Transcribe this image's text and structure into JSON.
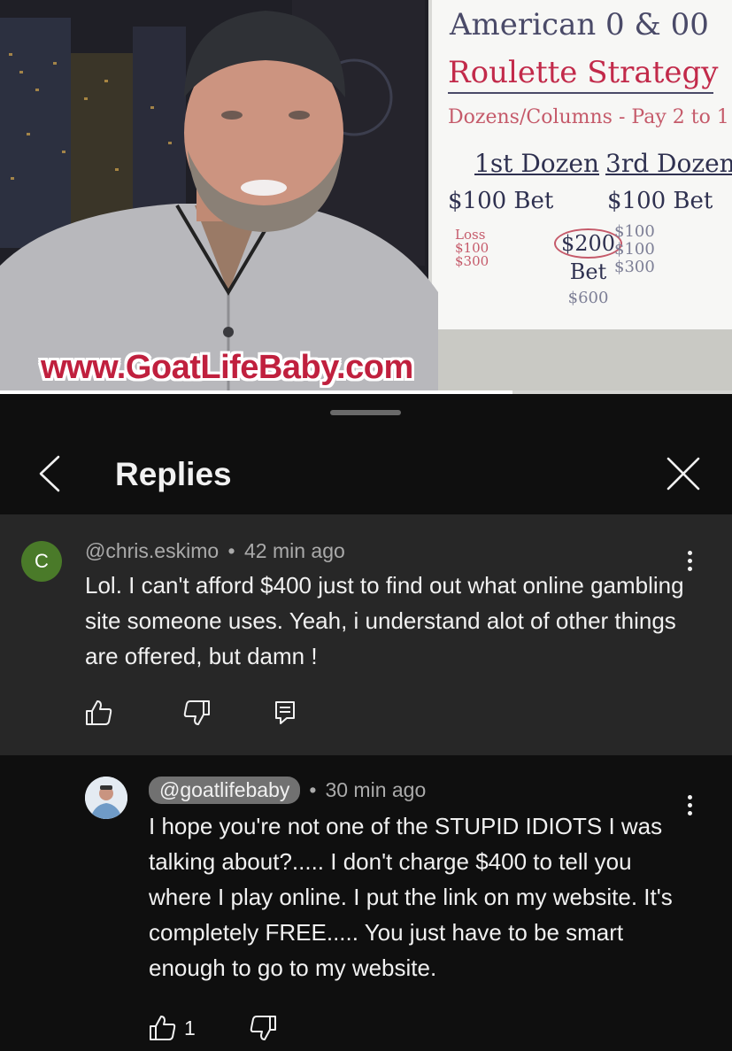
{
  "video": {
    "watermark": "www.GoatLifeBaby.com",
    "progress_fraction": 0.7,
    "whiteboard": {
      "title_line1": "American 0 & 00",
      "title_line2": "Roulette Strategy",
      "subtitle": "Dozens/Columns - Pay 2 to 1",
      "col1": "1st Dozen",
      "col2": "3rd Dozen",
      "bet1": "$100 Bet",
      "bet2": "$100 Bet",
      "loss_note": "Loss $100 $300",
      "mid_amount": "$200",
      "mid_bet": "Bet",
      "mid_total": "$600",
      "side_notes": "$100 $100 $300"
    }
  },
  "panel": {
    "title": "Replies",
    "back_icon": "chevron-left-icon",
    "close_icon": "close-icon"
  },
  "parent_comment": {
    "avatar_letter": "C",
    "avatar_color": "#4a7a29",
    "author": "@chris.eskimo",
    "separator": "•",
    "time": "42 min ago",
    "text": "Lol. I can't afford $400 just to find out what online gambling site someone uses. Yeah, i understand alot of other things are offered,  but damn !",
    "actions": [
      "like-icon",
      "dislike-icon",
      "reply-icon"
    ]
  },
  "reply_comment": {
    "author": "@goatlifebaby",
    "separator": "•",
    "time": "30 min ago",
    "text": "I hope you're not one of the STUPID IDIOTS I was talking about?..... I don't charge $400 to tell you where I play online. I put the link on my website. It's completely FREE..... You just have to be smart enough to go to my website.",
    "like_count": "1",
    "actions": [
      "like-icon",
      "dislike-icon"
    ]
  },
  "colors": {
    "background": "#0f0f0f",
    "parent_bg": "#272727",
    "chip_bg": "#717171",
    "watermark": "#c0203e"
  }
}
